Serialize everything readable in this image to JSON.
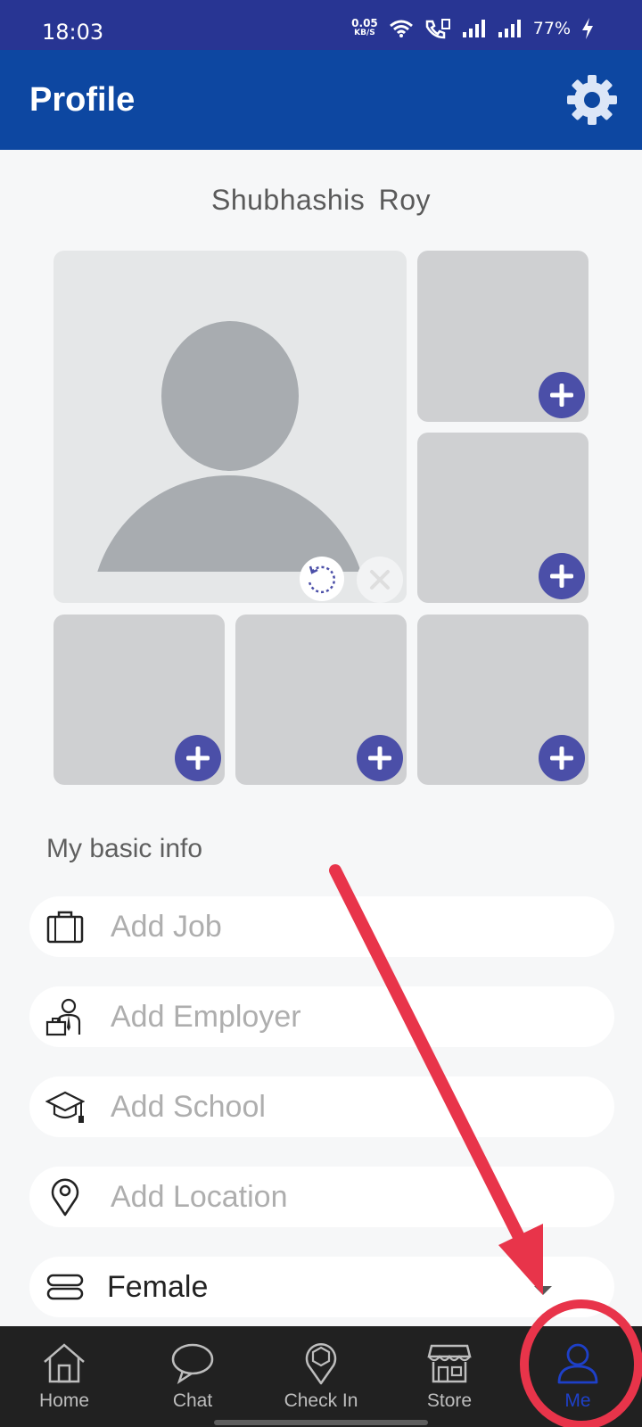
{
  "status_bar": {
    "time": "18:03",
    "speed_value": "0.05",
    "speed_unit": "KB/S",
    "battery": "77%",
    "icons": [
      "wifi-icon",
      "volte-icon",
      "signal-icon",
      "signal-icon",
      "charging-icon"
    ]
  },
  "app_bar": {
    "title": "Profile",
    "settings_icon": "gear-icon"
  },
  "profile": {
    "name": "Shubhashis  Roy"
  },
  "photos": {
    "slots": 6,
    "add_icon": "plus-icon"
  },
  "basic_info": {
    "heading": "My basic info",
    "fields": [
      {
        "icon": "briefcase-icon",
        "placeholder": "Add Job"
      },
      {
        "icon": "employer-icon",
        "placeholder": "Add Employer"
      },
      {
        "icon": "graduation-cap-icon",
        "placeholder": "Add School"
      },
      {
        "icon": "location-pin-icon",
        "placeholder": "Add Location"
      }
    ],
    "gender": {
      "icon": "gender-icon",
      "value": "Female"
    }
  },
  "bottom_nav": {
    "items": [
      {
        "label": "Home",
        "icon": "home-icon"
      },
      {
        "label": "Chat",
        "icon": "chat-bubble-icon"
      },
      {
        "label": "Check In",
        "icon": "check-in-pin-icon"
      },
      {
        "label": "Store",
        "icon": "store-icon"
      },
      {
        "label": "Me",
        "icon": "user-icon",
        "active": true
      }
    ]
  },
  "colors": {
    "status_bar": "#283593",
    "app_bar": "#0d47a1",
    "accent": "#4b4fa8",
    "annotation": "#e8344a",
    "nav_active": "#1e40c8"
  }
}
